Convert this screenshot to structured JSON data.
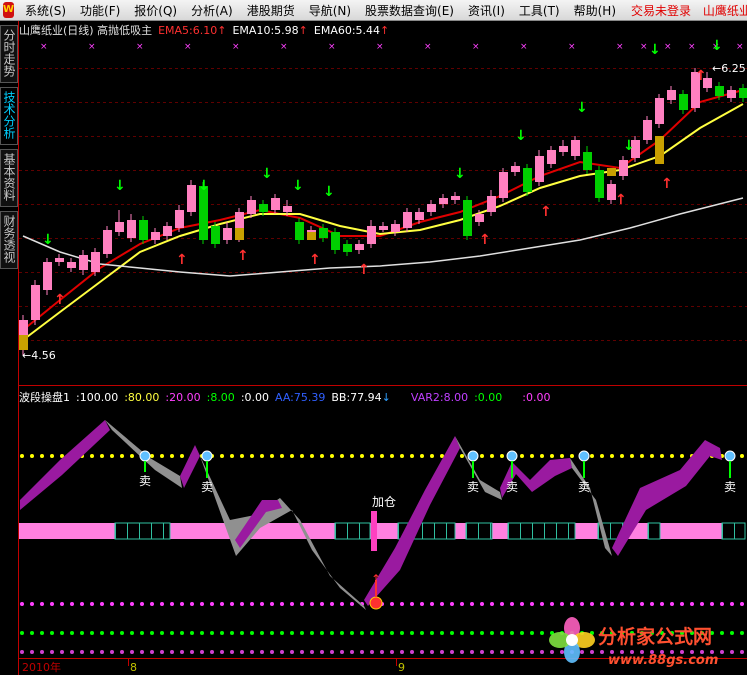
{
  "menu": {
    "items": [
      "系统(S)",
      "功能(F)",
      "报价(Q)",
      "分析(A)",
      "港股期货",
      "导航(N)",
      "股票数据查询(E)",
      "资讯(I)",
      "工具(T)",
      "帮助(H)"
    ],
    "status": "交易未登录",
    "stock": "山鹰纸业"
  },
  "sidebar": {
    "tabs": [
      "分时走势",
      "技术分析",
      "基本资料",
      "财务透视"
    ]
  },
  "main_chart": {
    "title": "山鹰纸业(日线) 高抛低吸主",
    "ema5": "EMA5:6.10",
    "ema10": "EMA10:5.98",
    "ema60": "EMA60:5.44",
    "high_label": "6.25",
    "low_label": "4.56"
  },
  "sub_chart": {
    "name": "波段操盘1",
    "v1": ":100.00",
    "v2": ":80.00",
    "v3": ":20.00",
    "v4": ":8.00",
    "v5": ":0.00",
    "aa": "AA:75.39",
    "bb": "BB:77.94",
    "var2": "VAR2:8.00",
    "v6": ":0.00",
    "v7": ":0.00",
    "sell_label": "卖",
    "add_label": "加仓"
  },
  "axis": {
    "year": "2010年",
    "month8": "8",
    "month9": "9"
  },
  "watermark": {
    "brand": "分析家公式网",
    "url": "www.88gs.com"
  },
  "colors": {
    "up_candle": "#ff80c0",
    "down_candle": "#00d000",
    "ema5": "#e00000",
    "ema10": "#ffff40",
    "ema60": "#e0e0e0",
    "band_up": "#9a1aa0",
    "band_down": "#909090"
  }
}
